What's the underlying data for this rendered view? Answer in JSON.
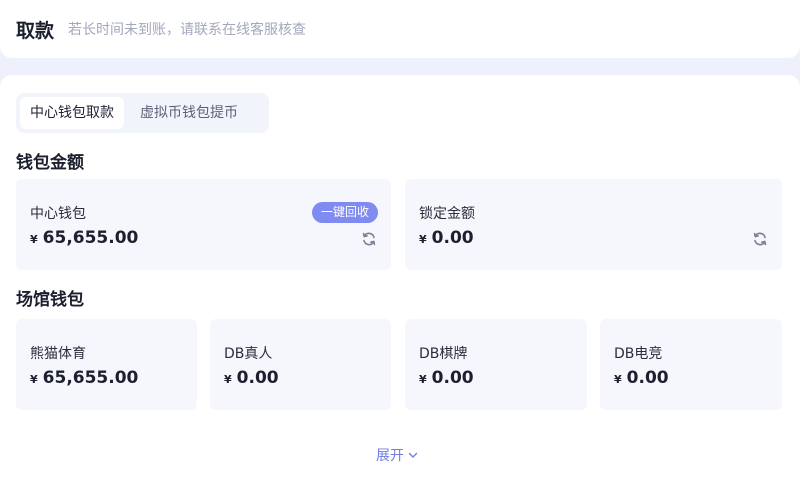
{
  "header": {
    "title": "取款",
    "notice": "若长时间未到账，请联系在线客服核查"
  },
  "tabs": [
    {
      "label": "中心钱包取款",
      "active": true
    },
    {
      "label": "虚拟币钱包提币",
      "active": false
    }
  ],
  "wallet_section": {
    "title": "钱包金额",
    "center": {
      "label": "中心钱包",
      "currency": "¥",
      "amount": "65,655.00",
      "recall_label": "一键回收",
      "icon": "refresh-icon"
    },
    "locked": {
      "label": "锁定金额",
      "currency": "¥",
      "amount": "0.00",
      "icon": "refresh-icon"
    }
  },
  "venue_section": {
    "title": "场馆钱包",
    "items": [
      {
        "label": "熊猫体育",
        "currency": "¥",
        "amount": "65,655.00"
      },
      {
        "label": "DB真人",
        "currency": "¥",
        "amount": "0.00"
      },
      {
        "label": "DB棋牌",
        "currency": "¥",
        "amount": "0.00"
      },
      {
        "label": "DB电竞",
        "currency": "¥",
        "amount": "0.00"
      }
    ]
  },
  "expand": {
    "label": "展开",
    "icon": "chevron-down-icon"
  },
  "colors": {
    "accent": "#7f8bf0",
    "link": "#6f7de8",
    "card_bg": "#f6f7fc",
    "page_bg": "#eef0fb"
  }
}
